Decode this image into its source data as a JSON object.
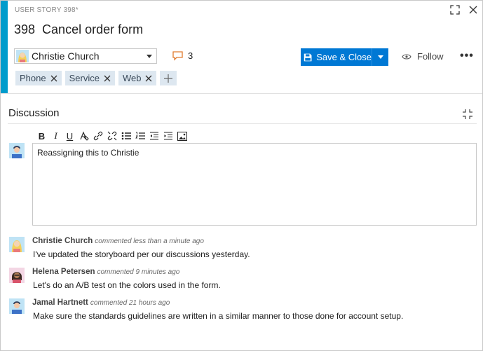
{
  "work_item": {
    "type_label": "USER STORY 398*",
    "id": "398",
    "title": "Cancel order form"
  },
  "assigned_to": {
    "name": "Christie Church"
  },
  "comments_count": "3",
  "toolbar": {
    "save_close_label": "Save & Close",
    "follow_label": "Follow",
    "more_label": "•••"
  },
  "tags": [
    "Phone",
    "Service",
    "Web"
  ],
  "discussion": {
    "title": "Discussion",
    "editor_text": "Reassigning this to Christie",
    "format_buttons": [
      "B",
      "I",
      "U"
    ]
  },
  "comments": [
    {
      "author": "Christie Church",
      "when": "commented less than a minute ago",
      "text": "I've updated the storyboard per our discussions yesterday."
    },
    {
      "author": "Helena Petersen",
      "when": "commented 9 minutes ago",
      "text": "Let's do an A/B test on the colors used in the form."
    },
    {
      "author": "Jamal Hartnett",
      "when": "commented 21 hours ago",
      "text": "Make sure the standards guidelines are written in a similar manner to those done for account setup."
    }
  ],
  "colors": {
    "accent_bar": "#009ccc",
    "primary_button": "#0078d4",
    "tag_bg": "#dde7f0",
    "comment_icon": "#e07b2e"
  }
}
